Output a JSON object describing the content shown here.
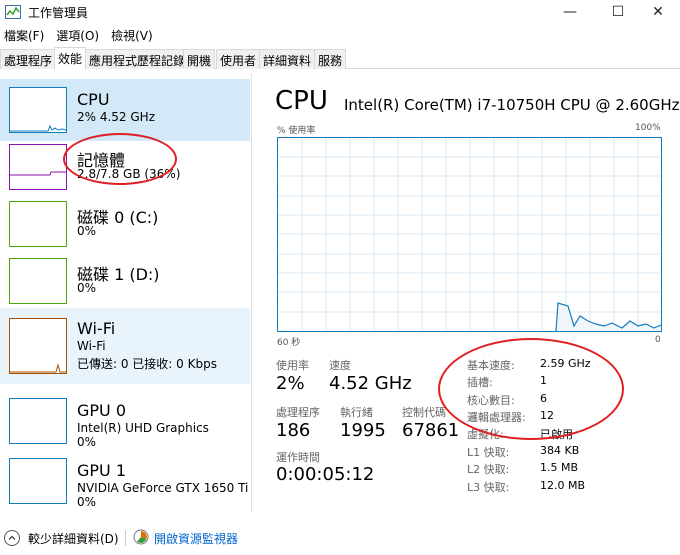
{
  "window": {
    "title": "工作管理員",
    "min": "—",
    "max": "☐",
    "close": "✕"
  },
  "menu": [
    "檔案(F)",
    "選項(O)",
    "檢視(V)"
  ],
  "tabs": [
    "處理程序",
    "效能",
    "應用程式歷程記錄",
    "開機",
    "使用者",
    "詳細資料",
    "服務"
  ],
  "active_tab": "效能",
  "sidebar": {
    "items": [
      {
        "title": "CPU",
        "sub1": "2% 4.52 GHz",
        "sub2": "",
        "color": "#117dbb"
      },
      {
        "title": "記憶體",
        "sub1": "2.8/7.8 GB (36%)",
        "sub2": "",
        "color": "#8b12ae"
      },
      {
        "title": "磁碟 0 (C:)",
        "sub1": "0%",
        "sub2": "",
        "color": "#4da60c"
      },
      {
        "title": "磁碟 1 (D:)",
        "sub1": "0%",
        "sub2": "",
        "color": "#4da60c"
      },
      {
        "title": "Wi-Fi",
        "sub1": "Wi-Fi",
        "sub2": "已傳送: 0 已接收: 0 Kbps",
        "color": "#a74f01"
      },
      {
        "title": "GPU 0",
        "sub1": "Intel(R) UHD Graphics",
        "sub2": "0%",
        "color": "#117dbb"
      },
      {
        "title": "GPU 1",
        "sub1": "NVIDIA GeForce GTX 1650 Ti",
        "sub2": "0%",
        "color": "#117dbb"
      }
    ]
  },
  "main": {
    "title": "CPU",
    "model": "Intel(R) Core(TM) i7-10750H CPU @ 2.60GHz",
    "util_label": "% 使用率",
    "util_max": "100%",
    "graph_left": "60 秒",
    "graph_right": "0",
    "stats": {
      "usage_label": "使用率",
      "usage": "2%",
      "speed_label": "速度",
      "speed": "4.52 GHz",
      "proc_label": "處理程序",
      "proc": "186",
      "threads_label": "執行緒",
      "threads": "1995",
      "handles_label": "控制代碼",
      "handles": "67861",
      "uptime_label": "運作時間",
      "uptime": "0:00:05:12"
    },
    "info": [
      {
        "label": "基本速度:",
        "value": "2.59 GHz"
      },
      {
        "label": "插槽:",
        "value": "1"
      },
      {
        "label": "核心數目:",
        "value": "6"
      },
      {
        "label": "邏輯處理器:",
        "value": "12"
      },
      {
        "label": "虛擬化:",
        "value": "已啟用"
      },
      {
        "label": "L1 快取:",
        "value": "384 KB"
      },
      {
        "label": "L2 快取:",
        "value": "1.5 MB"
      },
      {
        "label": "L3 快取:",
        "value": "12.0 MB"
      }
    ]
  },
  "footer": {
    "fewer": "較少詳細資料(D)",
    "resource_monitor": "開啟資源監視器"
  },
  "colors": {
    "cpu": "#117dbb",
    "selected_bg": "#d4e9f7",
    "annotation": "#e02020"
  }
}
